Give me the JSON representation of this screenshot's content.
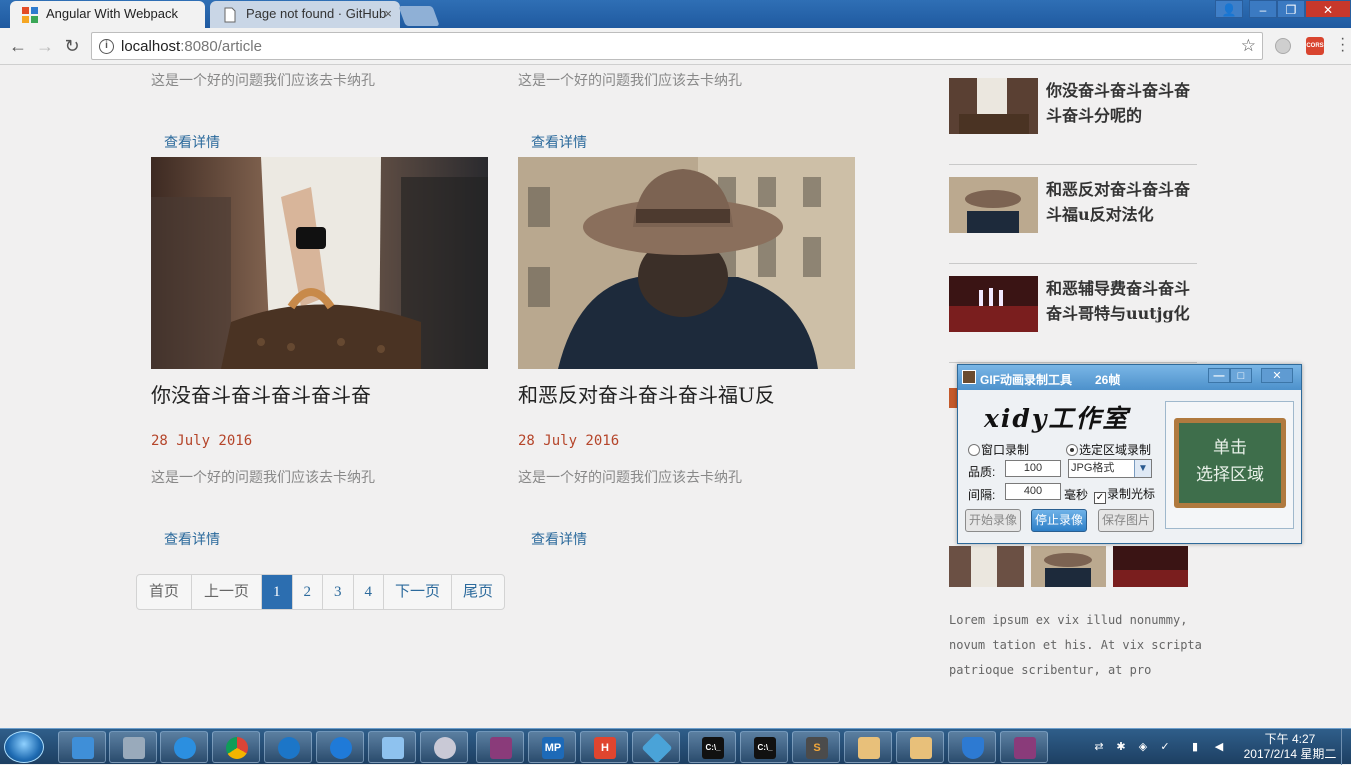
{
  "browser": {
    "tabs": [
      {
        "title": "Angular With Webpack",
        "active": true
      },
      {
        "title": "Page not found · GitHub",
        "active": false
      }
    ],
    "close_glyph": "×",
    "url_host": "localhost",
    "url_path": ":8080/article",
    "info_glyph": "i",
    "star_glyph": "☆",
    "ext_cors_label": "CORS",
    "window_buttons": {
      "minimize": "–",
      "maximize": "❐",
      "close": "✕",
      "user": "👤"
    }
  },
  "articles": {
    "top_row": [
      {
        "excerpt": "这是一个好的问题我们应该去卡纳孔",
        "more": "查看详情"
      },
      {
        "excerpt": "这是一个好的问题我们应该去卡纳孔",
        "more": "查看详情"
      }
    ],
    "cards": [
      {
        "title": "你没奋斗奋斗奋斗奋斗奋",
        "date": "28 July 2016",
        "excerpt": "这是一个好的问题我们应该去卡纳孔",
        "more": "查看详情",
        "image": "woman-with-handbag-photo"
      },
      {
        "title": "和恶反对奋斗奋斗奋斗福U反",
        "date": "28 July 2016",
        "excerpt": "这是一个好的问题我们应该去卡纳孔",
        "more": "查看详情",
        "image": "man-with-hat-photo"
      }
    ]
  },
  "pagination": {
    "first": "首页",
    "prev": "上一页",
    "pages": [
      "1",
      "2",
      "3",
      "4"
    ],
    "current": "1",
    "next": "下一页",
    "last": "尾页"
  },
  "sidebar": {
    "posts": [
      {
        "title": "你没奋斗奋斗奋斗奋斗奋斗分呢的"
      },
      {
        "title": "和恶反对奋斗奋斗奋斗福u反对法化"
      },
      {
        "title": "和恶辅导费奋斗奋斗奋斗哥特与uutjg化"
      }
    ],
    "lorem": "Lorem ipsum ex vix illud nonummy, novum tation et his. At vix scripta patrioque scribentur, at pro"
  },
  "gif_tool": {
    "title": "GIF动画录制工具",
    "frames": "26帧",
    "logo": "xidy工作室",
    "radio_window": "窗口录制",
    "radio_region": "选定区域录制",
    "quality_label": "品质:",
    "quality_value": "100",
    "format_value": "JPG格式",
    "interval_label": "间隔:",
    "interval_value": "400",
    "interval_unit": "毫秒",
    "cursor_label": "录制光标",
    "btn_start": "开始录像",
    "btn_stop": "停止录像",
    "btn_save": "保存图片",
    "board_line1": "单击",
    "board_line2": "选择区域",
    "min_glyph": "—",
    "max_glyph": "□",
    "close_glyph": "✕"
  },
  "taskbar": {
    "clock_time": "下午 4:27",
    "clock_date": "2017/2/14 星期二",
    "apps": [
      "ie-icon",
      "chrome-icon",
      "k-icon",
      "s-icon",
      "notepad-icon",
      "cat-icon",
      "winrar-icon",
      "mp-icon",
      "h-icon",
      "tool-icon",
      "cmd-icon",
      "cmd-icon",
      "sublime-icon",
      "folder-icon",
      "folder-icon",
      "shield-icon",
      "winrar-icon"
    ],
    "mp_label": "MP",
    "h_label": "H",
    "cmd_label": "C:\\_",
    "s_label": "S"
  },
  "colors": {
    "link": "#2c6a9c",
    "date": "#b5452a",
    "pager_active": "#2c6eb0"
  }
}
